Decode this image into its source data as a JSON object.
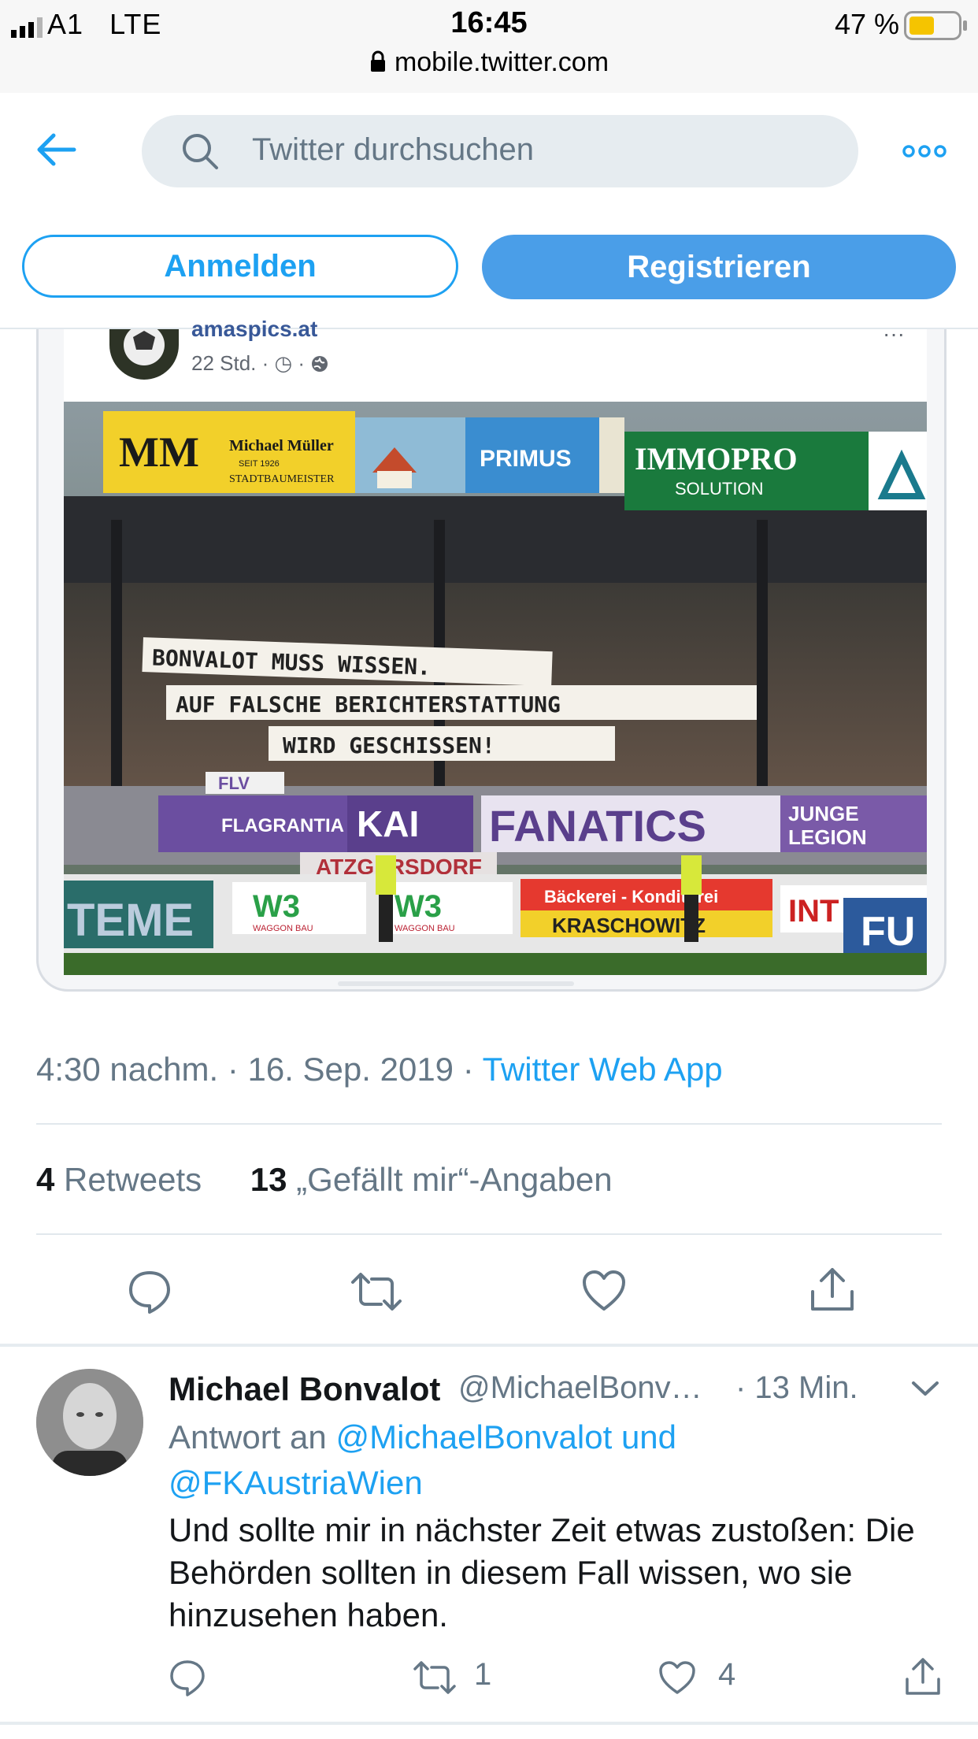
{
  "status_bar": {
    "carrier": "A1",
    "network": "LTE",
    "time": "16:45",
    "battery": "47 %",
    "url": "mobile.twitter.com"
  },
  "header": {
    "search_placeholder": "Twitter durchsuchen",
    "login_label": "Anmelden",
    "register_label": "Registrieren"
  },
  "embedded_post": {
    "author": "amaspics.at",
    "meta": "22 Std. · ◷ ·",
    "photo": {
      "sponsor_banners": [
        "MM",
        "Michael Müller",
        "SEIT 1926",
        "STADTBAUMEISTER",
        "PRIMUS",
        "IMMOPRO",
        "SOLUTION"
      ],
      "fan_banners": [
        "BONVALOT MUSS WISSEN.",
        "AUF FALSCHE BERICHTERSTATTUNG",
        "WIRD GESCHISSEN!"
      ],
      "fence_banners": [
        "FLV",
        "FLAGRANTIA",
        "KAI",
        "FANATICS",
        "JUNGE LEGION",
        "ATZGERSDORF"
      ],
      "pitch_banners": [
        "TEME",
        "W3",
        "WAGGON BAU",
        "Bäckerei - Konditorei",
        "KRASCHOWITZ",
        "INT",
        "FU"
      ]
    }
  },
  "tweet": {
    "time": "4:30 nachm.",
    "date": "16. Sep. 2019",
    "source": "Twitter Web App",
    "retweets_count": "4",
    "retweets_label": "Retweets",
    "likes_count": "13",
    "likes_label": "„Gefällt mir“-Angaben"
  },
  "reply": {
    "name": "Michael Bonvalot",
    "handle": "@MichaelBonv…",
    "time": "· 13 Min.",
    "reply_prefix": "Antwort an",
    "reply_to_1": "@MichaelBonvalot",
    "reply_and": "und",
    "reply_to_2": "@FKAustriaWien",
    "text": "Und sollte mir in nächster Zeit etwas zustoßen: Die Behörden sollten in diesem Fall wissen, wo sie hinzusehen haben.",
    "retweet_count": "1",
    "like_count": "4"
  },
  "colors": {
    "accent": "#1da1f2",
    "register_bg": "#4a9ee8",
    "muted": "#657786",
    "separator": "#e1e8ed"
  }
}
